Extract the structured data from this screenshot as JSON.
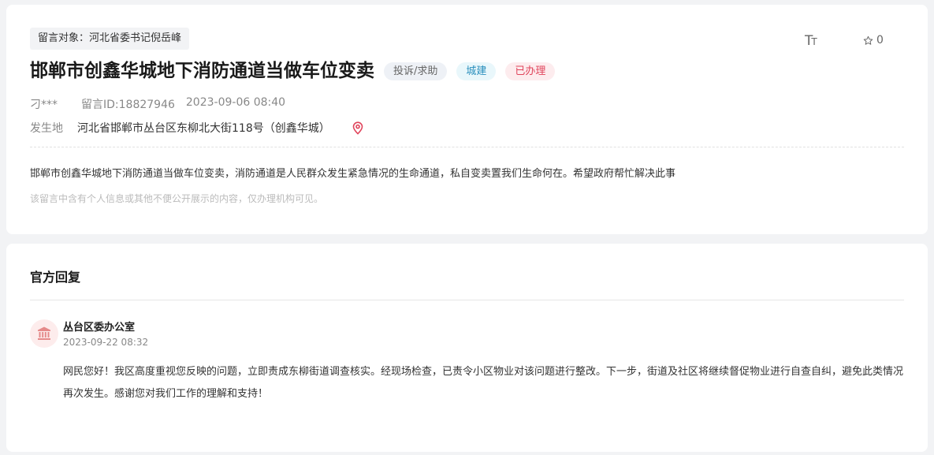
{
  "post": {
    "target": "留言对象：河北省委书记倪岳峰",
    "title": "邯郸市创鑫华城地下消防通道当做车位变卖",
    "tags": {
      "type": "投诉/求助",
      "field": "城建",
      "status": "已办理"
    },
    "user": "刁***",
    "message_id": "留言ID:18827946",
    "datetime": "2023-09-06 08:40",
    "location_label": "发生地",
    "location": "河北省邯郸市丛台区东柳北大街118号（创鑫华城）",
    "content": "邯郸市创鑫华城地下消防通道当做车位变卖，消防通道是人民群众发生紧急情况的生命通道，私自变卖置我们生命何在。希望政府帮忙解决此事",
    "privacy_note": "该留言中含有个人信息或其他不便公开展示的内容，仅办理机构可见。"
  },
  "toolbar": {
    "font_size_icon": "text-size-icon",
    "favorite_icon": "star-icon",
    "favorite_count": "0"
  },
  "reply": {
    "heading": "官方回复",
    "department_icon": "government-building-icon",
    "department": "丛台区委办公室",
    "datetime": "2023-09-22 08:32",
    "text": "网民您好！我区高度重视您反映的问题，立即责成东柳街道调查核实。经现场检查，已责令小区物业对该问题进行整改。下一步，街道及社区将继续督促物业进行自查自纠，避免此类情况再次发生。感谢您对我们工作的理解和支持！"
  },
  "colors": {
    "status_tag": "#e0445b",
    "field_tag": "#2a8fbd",
    "location_pin": "#e0445b"
  }
}
